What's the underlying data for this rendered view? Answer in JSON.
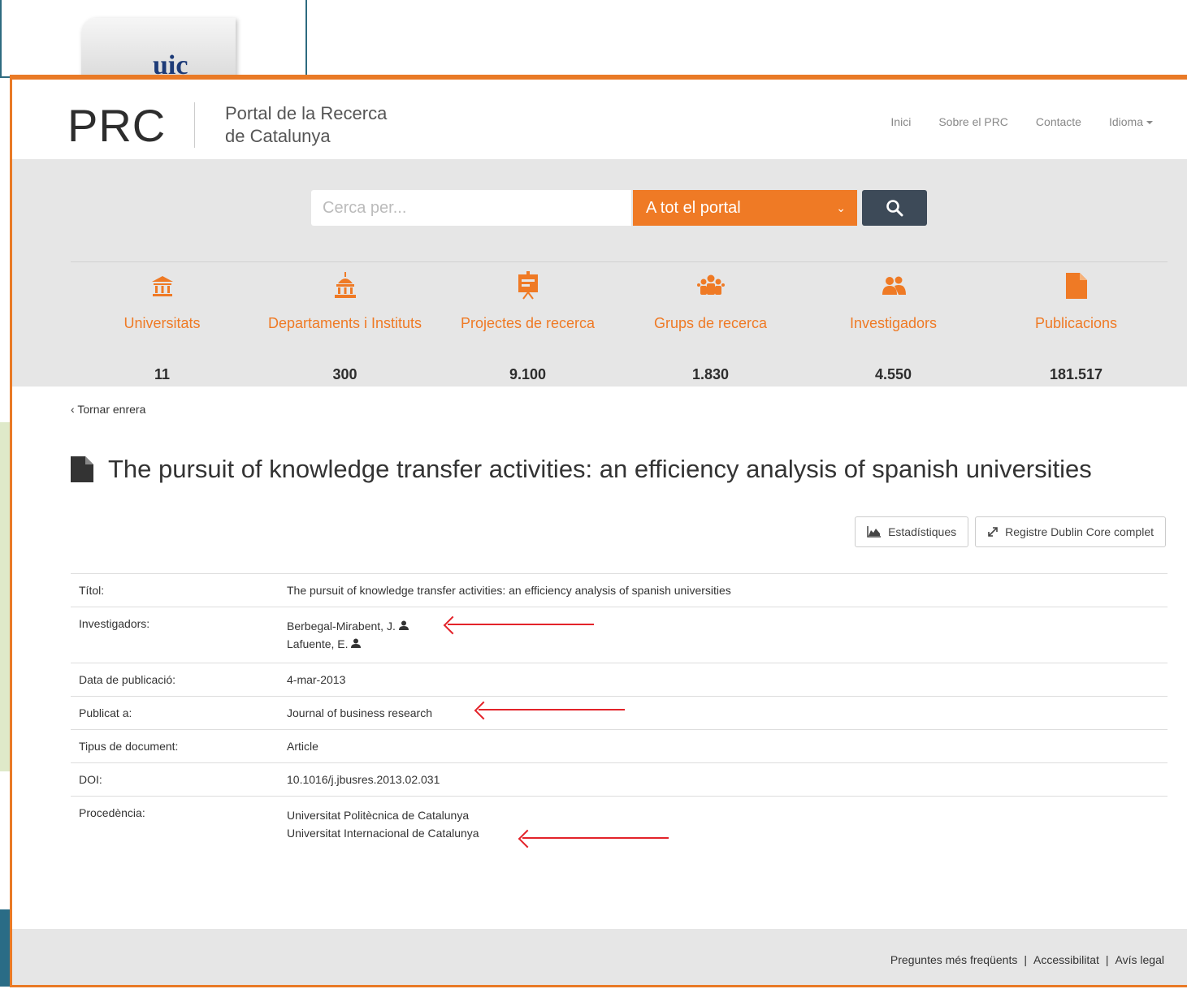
{
  "background": {
    "logo_text": "uic"
  },
  "header": {
    "logo": "PRC",
    "subtitle_line1": "Portal de la Recerca",
    "subtitle_line2": "de Catalunya",
    "nav": [
      "Inici",
      "Sobre el PRC",
      "Contacte",
      "Idioma"
    ]
  },
  "search": {
    "placeholder": "Cerca per...",
    "scope": "A tot el portal",
    "button_icon": "search-icon"
  },
  "stats": [
    {
      "label": "Universitats",
      "value": "11",
      "icon": "university-icon"
    },
    {
      "label": "Departaments i Instituts",
      "value": "300",
      "icon": "institute-icon"
    },
    {
      "label": "Projectes de recerca",
      "value": "9.100",
      "icon": "presentation-icon"
    },
    {
      "label": "Grups de recerca",
      "value": "1.830",
      "icon": "group-icon"
    },
    {
      "label": "Investigadors",
      "value": "4.550",
      "icon": "users-icon"
    },
    {
      "label": "Publicacions",
      "value": "181.517",
      "icon": "document-icon"
    }
  ],
  "back": "Tornar enrera",
  "title": "The pursuit of knowledge transfer activities: an efficiency analysis of spanish universities",
  "buttons": {
    "stats": "Estadístiques",
    "dublin": "Registre Dublin Core complet"
  },
  "record": {
    "titol_label": "Títol:",
    "titol": "The pursuit of knowledge transfer activities: an efficiency analysis of spanish universities",
    "investigadors_label": "Investigadors:",
    "investigadors": [
      "Berbegal-Mirabent, J.",
      "Lafuente, E."
    ],
    "data_label": "Data de publicació:",
    "data": "4-mar-2013",
    "publicat_label": "Publicat a:",
    "publicat": "Journal of business research",
    "tipus_label": "Tipus de document:",
    "tipus": "Article",
    "doi_label": "DOI:",
    "doi": "10.1016/j.jbusres.2013.02.031",
    "procedencia_label": "Procedència:",
    "procedencia": [
      "Universitat Politècnica de Catalunya",
      "Universitat Internacional de Catalunya"
    ]
  },
  "footer": {
    "links": [
      "Preguntes més freqüents",
      "Accessibilitat",
      "Avís legal"
    ],
    "separator": "|"
  },
  "colors": {
    "accent": "#ef7a25",
    "dark_button": "#3d4a58",
    "annotation_arrow": "#e3232a"
  }
}
